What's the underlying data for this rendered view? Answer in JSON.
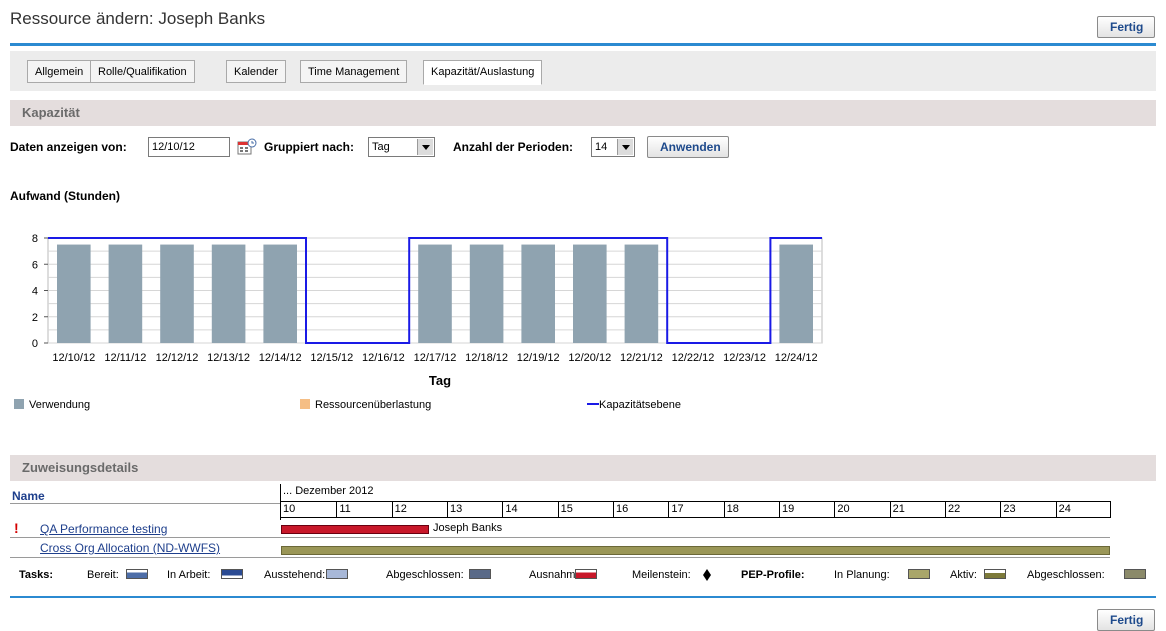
{
  "page": {
    "title": "Ressource ändern: Joseph Banks",
    "done_label": "Fertig"
  },
  "tabs": [
    {
      "label": "Allgemein"
    },
    {
      "label": "Rolle/Qualifikation"
    },
    {
      "label": "Kalender"
    },
    {
      "label": "Time Management"
    },
    {
      "label": "Kapazität/Auslastung"
    }
  ],
  "capacity": {
    "section_title": "Kapazität",
    "show_from_label": "Daten anzeigen von:",
    "show_from_value": "12/10/12",
    "group_by_label": "Gruppiert nach:",
    "group_by_value": "Tag",
    "periods_label": "Anzahl der Perioden:",
    "periods_value": "14",
    "apply_label": "Anwenden",
    "chart_title": "Aufwand (Stunden)"
  },
  "chart_data": {
    "type": "bar",
    "title": "Aufwand (Stunden)",
    "xlabel": "Tag",
    "ylabel": "",
    "ylim": [
      0,
      8
    ],
    "yticks": [
      0,
      2,
      4,
      6,
      8
    ],
    "categories": [
      "12/10/12",
      "12/11/12",
      "12/12/12",
      "12/13/12",
      "12/14/12",
      "12/15/12",
      "12/16/12",
      "12/17/12",
      "12/18/12",
      "12/19/12",
      "12/20/12",
      "12/21/12",
      "12/22/12",
      "12/23/12",
      "12/24/12"
    ],
    "series": [
      {
        "name": "Verwendung",
        "type": "bar",
        "color": "#8fa3b0",
        "values": [
          7.5,
          7.5,
          7.5,
          7.5,
          7.5,
          0,
          0,
          7.5,
          7.5,
          7.5,
          7.5,
          7.5,
          0,
          0,
          7.5
        ]
      },
      {
        "name": "Ressourcenüberlastung",
        "type": "bar",
        "color": "#f5be85",
        "values": [
          0,
          0,
          0,
          0,
          0,
          0,
          0,
          0,
          0,
          0,
          0,
          0,
          0,
          0,
          0
        ]
      },
      {
        "name": "Kapazitätsebene",
        "type": "line",
        "color": "#1a1ae6",
        "values": [
          8,
          8,
          8,
          8,
          8,
          0,
          0,
          8,
          8,
          8,
          8,
          8,
          0,
          0,
          8
        ]
      }
    ],
    "grid": true,
    "legend_position": "bottom"
  },
  "assignments": {
    "section_title": "Zuweisungsdetails",
    "name_header": "Name",
    "month_label": "... Dezember 2012",
    "days": [
      "10",
      "11",
      "12",
      "13",
      "14",
      "15",
      "16",
      "17",
      "18",
      "19",
      "20",
      "21",
      "22",
      "23",
      "24"
    ],
    "rows": [
      {
        "name": "QA Performance testing",
        "bar_label": "Joseph Banks",
        "exception": "!"
      },
      {
        "name": "Cross Org Allocation (ND-WWFS)"
      }
    ]
  },
  "legend": {
    "tasks_label": "Tasks:",
    "ready": "Bereit:",
    "in_progress": "In Arbeit:",
    "pending": "Ausstehend:",
    "completed": "Abgeschlossen:",
    "exception": "Ausnahme:",
    "milestone": "Meilenstein:",
    "pep_label": "PEP-Profile:",
    "planning": "In Planung:",
    "active": "Aktiv:",
    "pep_completed": "Abgeschlossen:"
  }
}
